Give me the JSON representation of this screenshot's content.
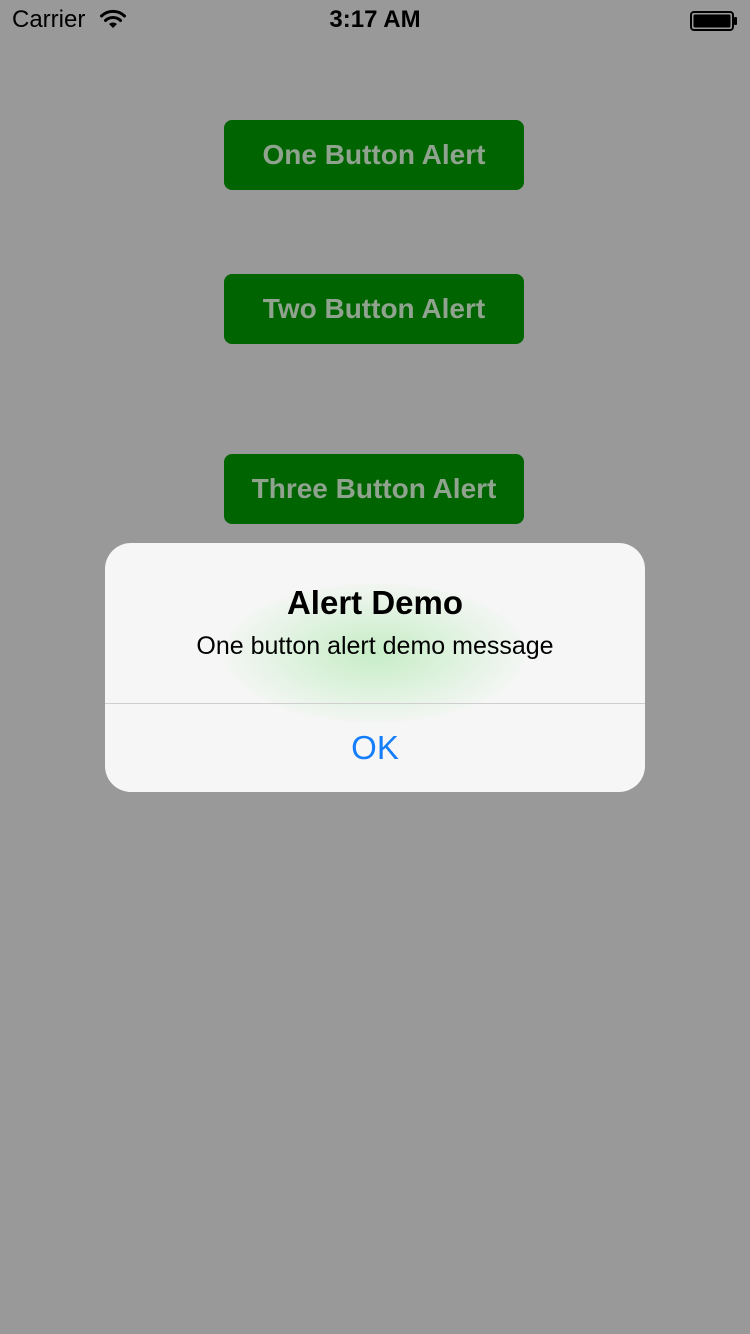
{
  "status_bar": {
    "carrier": "Carrier",
    "time": "3:17 AM",
    "wifi_icon": "wifi-icon",
    "battery_icon": "battery-icon"
  },
  "buttons": {
    "one": "One Button Alert",
    "two": "Two Button Alert",
    "three": "Three Button Alert"
  },
  "alert": {
    "title": "Alert Demo",
    "message": "One button alert demo message",
    "ok_label": "OK"
  },
  "colors": {
    "background": "#999999",
    "button_bg": "#006400",
    "button_text": "#8fa38f",
    "alert_bg": "#f6f6f6",
    "ok_text": "#147efb"
  }
}
